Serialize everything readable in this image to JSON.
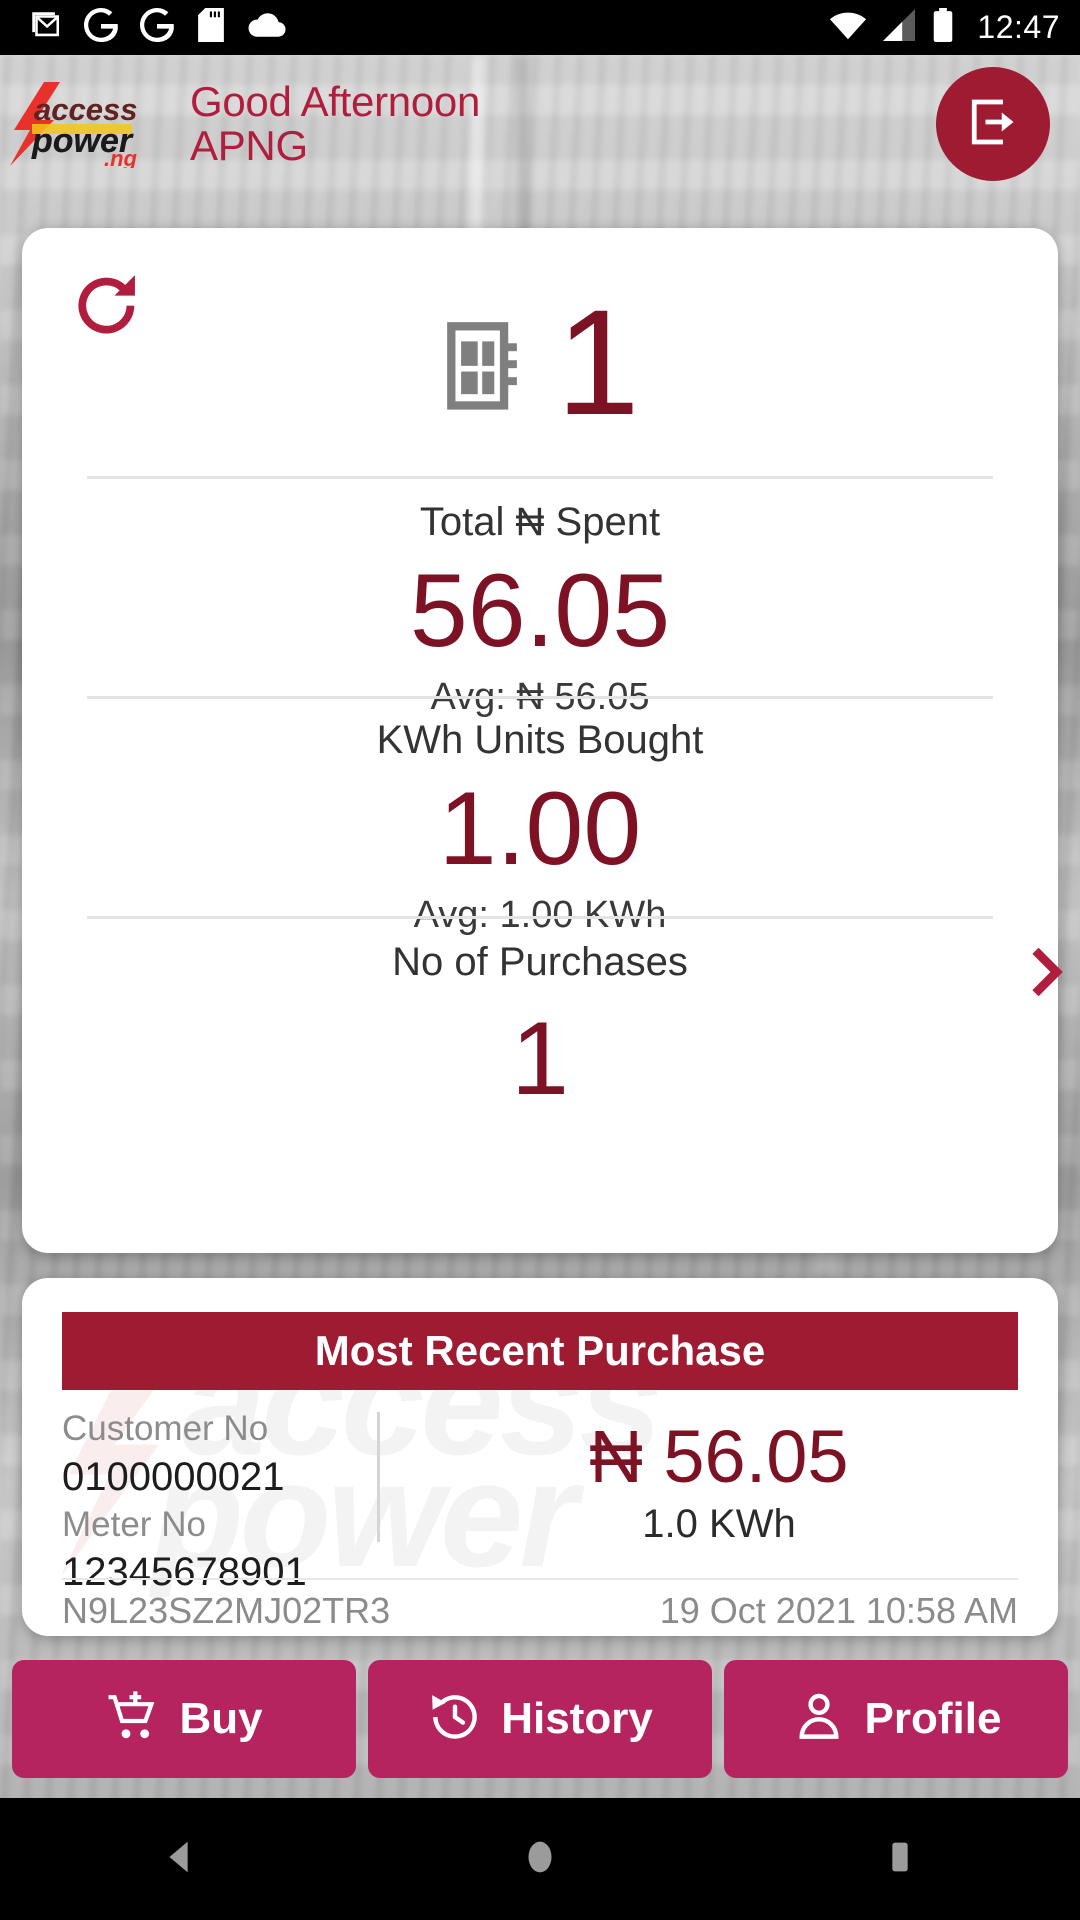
{
  "status_bar": {
    "time": "12:47",
    "left_icons": [
      "gmail-icon",
      "google-icon",
      "google-icon",
      "sd-card-icon",
      "cloud-icon"
    ],
    "right_icons": [
      "wifi-icon",
      "cellular-signal-icon",
      "battery-icon"
    ]
  },
  "app_bar": {
    "logo_line1": "access",
    "logo_line2": "power",
    "logo_suffix": ".ng",
    "greeting_line1": "Good Afternoon",
    "greeting_line2": "APNG",
    "logout_icon": "logout-icon"
  },
  "summary": {
    "refresh_icon": "refresh-icon",
    "meter_icon": "meter-icon",
    "meter_count": "1",
    "next_icon": "chevron-right-icon",
    "stats": [
      {
        "label": "Total ₦ Spent",
        "value": "56.05",
        "avg": "Avg:  ₦ 56.05"
      },
      {
        "label": "KWh Units Bought",
        "value": "1.00",
        "avg": "Avg:  1.00 KWh"
      },
      {
        "label": "No of Purchases",
        "value": "1",
        "avg": ""
      }
    ]
  },
  "recent_purchase": {
    "title": "Most Recent Purchase",
    "customer_label": "Customer No",
    "customer_value": "0100000021",
    "meter_label": "Meter No",
    "meter_value": "12345678901",
    "amount": "₦ 56.05",
    "units": "1.0 KWh",
    "transaction_id": "N9L23SZ2MJ02TR3",
    "datetime": "19 Oct 2021 10:58 AM",
    "watermark_line1": "access",
    "watermark_line2": "power"
  },
  "bottom_nav": [
    {
      "label": "Buy",
      "icon": "cart-plus-icon"
    },
    {
      "label": "History",
      "icon": "history-clock-icon"
    },
    {
      "label": "Profile",
      "icon": "person-icon"
    }
  ],
  "android_nav": [
    {
      "icon": "back-triangle-icon"
    },
    {
      "icon": "home-circle-icon"
    },
    {
      "icon": "recents-square-icon"
    }
  ],
  "colors": {
    "brand_dark_red": "#7d1224",
    "brand_red": "#9e1b32",
    "brand_pink": "#b5245f",
    "greeting_red": "#b11e3d"
  }
}
